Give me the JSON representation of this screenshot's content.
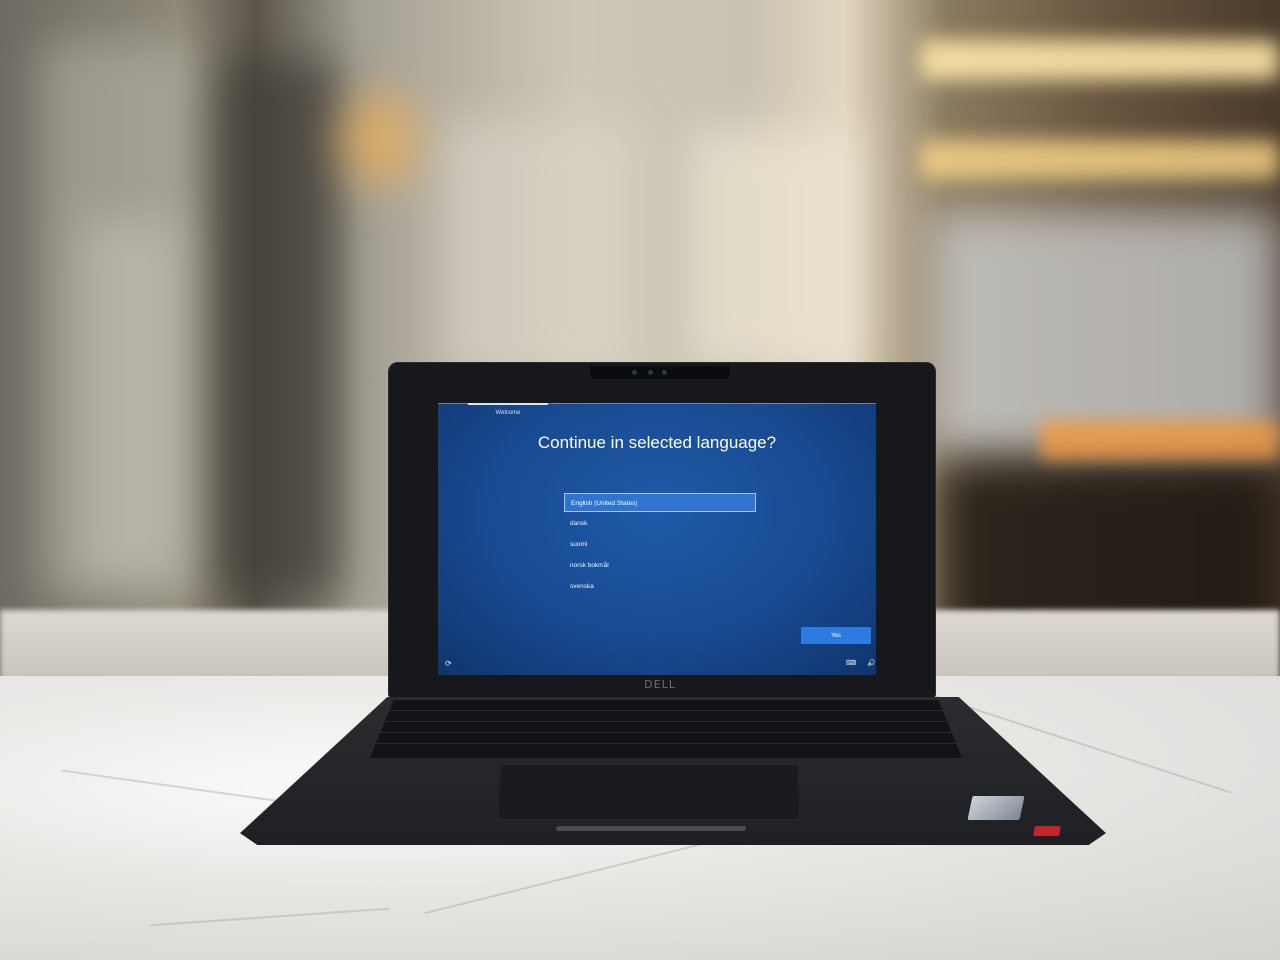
{
  "oobe": {
    "tab_label": "Welcome",
    "heading": "Continue in selected language?",
    "languages": [
      {
        "label": "English (United States)",
        "selected": true
      },
      {
        "label": "dansk",
        "selected": false
      },
      {
        "label": "suomi",
        "selected": false
      },
      {
        "label": "norsk bokmål",
        "selected": false
      },
      {
        "label": "svenska",
        "selected": false
      }
    ],
    "yes_button": "Yes",
    "icons": {
      "ease_of_access": "ease-of-access-icon",
      "keyboard": "keyboard-icon",
      "volume": "volume-icon"
    },
    "colors": {
      "background": "#184a91",
      "selected_item": "#2e74d1",
      "button": "#2b7be0"
    }
  },
  "laptop": {
    "brand_logo": "DELL"
  }
}
